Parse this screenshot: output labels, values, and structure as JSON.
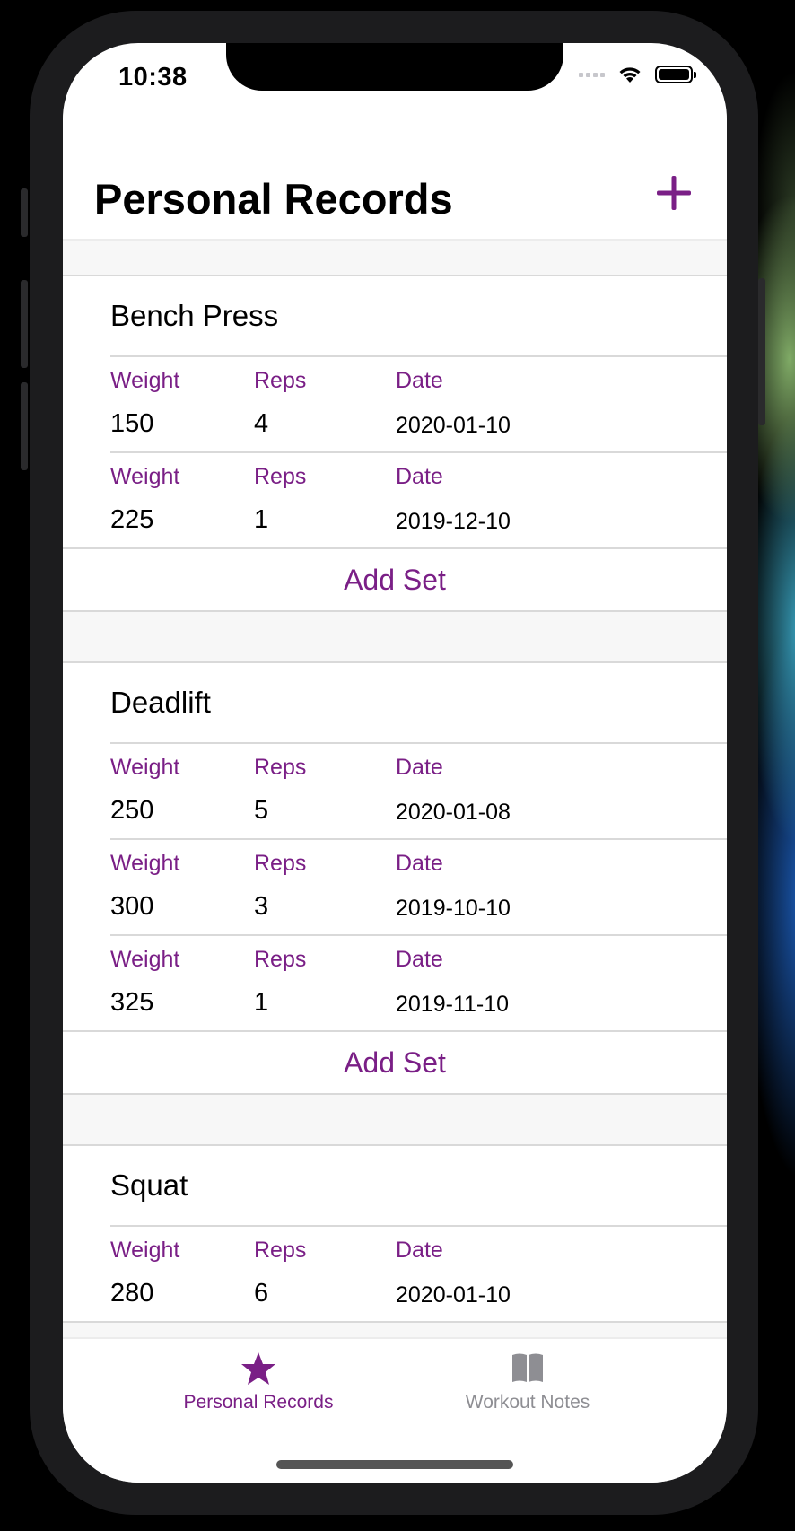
{
  "status_bar": {
    "time": "10:38"
  },
  "header": {
    "title": "Personal Records",
    "add_icon": "plus-icon"
  },
  "colors": {
    "accent": "#7a1f86",
    "inactive": "#8e8e93",
    "separator": "#d9d9d9",
    "background": "#f7f7f7"
  },
  "exercises": [
    {
      "name": "Bench Press",
      "sets": [
        {
          "weight_label": "Weight",
          "reps_label": "Reps",
          "date_label": "Date",
          "weight": "150",
          "reps": "4",
          "date": "2020-01-10"
        },
        {
          "weight_label": "Weight",
          "reps_label": "Reps",
          "date_label": "Date",
          "weight": "225",
          "reps": "1",
          "date": "2019-12-10"
        }
      ],
      "add_set_label": "Add Set"
    },
    {
      "name": "Deadlift",
      "sets": [
        {
          "weight_label": "Weight",
          "reps_label": "Reps",
          "date_label": "Date",
          "weight": "250",
          "reps": "5",
          "date": "2020-01-08"
        },
        {
          "weight_label": "Weight",
          "reps_label": "Reps",
          "date_label": "Date",
          "weight": "300",
          "reps": "3",
          "date": "2019-10-10"
        },
        {
          "weight_label": "Weight",
          "reps_label": "Reps",
          "date_label": "Date",
          "weight": "325",
          "reps": "1",
          "date": "2019-11-10"
        }
      ],
      "add_set_label": "Add Set"
    },
    {
      "name": "Squat",
      "sets": [
        {
          "weight_label": "Weight",
          "reps_label": "Reps",
          "date_label": "Date",
          "weight": "280",
          "reps": "6",
          "date": "2020-01-10"
        }
      ]
    }
  ],
  "tab_bar": {
    "tabs": [
      {
        "label": "Personal Records",
        "icon": "star-icon",
        "active": true
      },
      {
        "label": "Workout Notes",
        "icon": "book-icon",
        "active": false
      }
    ]
  }
}
